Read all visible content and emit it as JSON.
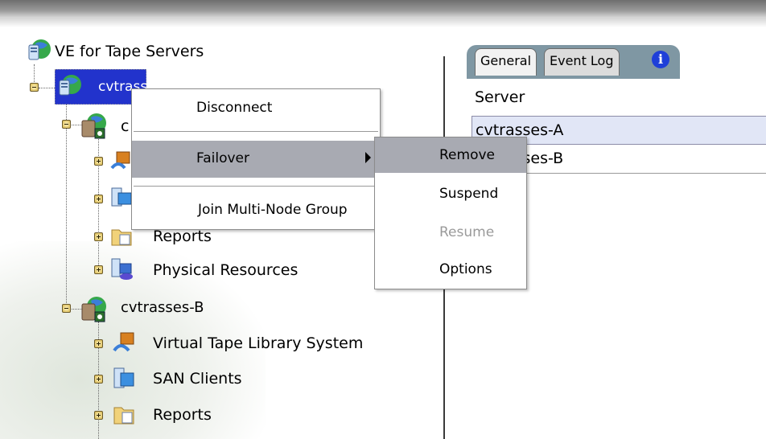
{
  "tree": {
    "root": "VE for Tape Servers",
    "selected_server": "cvtrasses",
    "server_a_partial": "c",
    "server_a_children": {
      "reports_partial": "Reports",
      "physical": "Physical Resources"
    },
    "server_b": "cvtrasses-B",
    "server_b_children": {
      "vtl": "Virtual Tape Library System",
      "san": "SAN Clients",
      "reports": "Reports"
    }
  },
  "context_menu": {
    "disconnect": "Disconnect",
    "failover": "Failover",
    "join": "Join Multi-Node Group"
  },
  "submenu": {
    "remove": "Remove",
    "suspend": "Suspend",
    "resume": "Resume",
    "options": "Options"
  },
  "tabs": {
    "general": "General",
    "event_log": "Event Log",
    "info": "i"
  },
  "server_list": {
    "header": "Server",
    "row_a": "cvtrasses-A",
    "row_b": "cvtrasses-B"
  },
  "colors": {
    "selection": "#2233cc",
    "menu_highlight": "#a8aab2",
    "tab_bar": "#7f97a3"
  }
}
